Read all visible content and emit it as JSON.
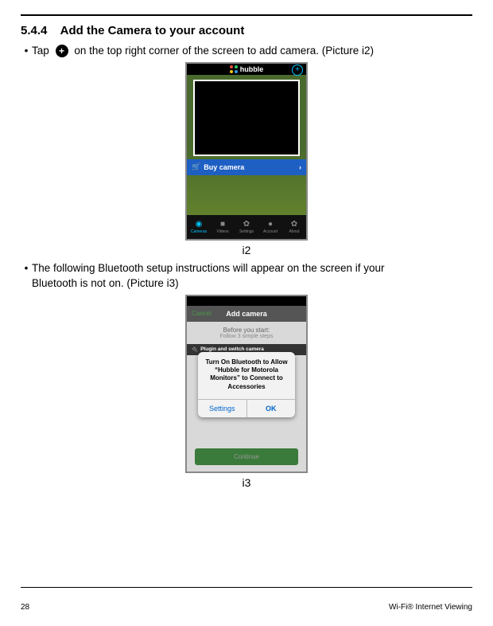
{
  "section": {
    "number": "5.4.4",
    "title": "Add the Camera to your account"
  },
  "bullet1": {
    "pre": "Tap",
    "post": "on the top right corner of the screen to add camera. (Picture i2)"
  },
  "bullet2": {
    "line1": "The following Bluetooth setup instructions will appear on the screen if your",
    "line2": "Bluetooth is not on. (Picture i3)"
  },
  "figure1": {
    "caption": "i2",
    "logo": "hubble",
    "buy_label": "Buy camera",
    "tabs": [
      "Cameras",
      "Videos",
      "Settings",
      "Account",
      "About"
    ]
  },
  "figure2": {
    "caption": "i3",
    "header_cancel": "Cancel",
    "header_title": "Add camera",
    "pre_title": "Before you start:",
    "pre_sub": "Follow 3 simple steps",
    "step_label": "Plugin and switch camera",
    "alert_msg": "Turn On Bluetooth to Allow “Hubble for Motorola Monitors” to Connect to Accessories",
    "alert_settings": "Settings",
    "alert_ok": "OK",
    "continue": "Continue"
  },
  "footer": {
    "page": "28",
    "label": "Wi-Fi® Internet Viewing"
  }
}
